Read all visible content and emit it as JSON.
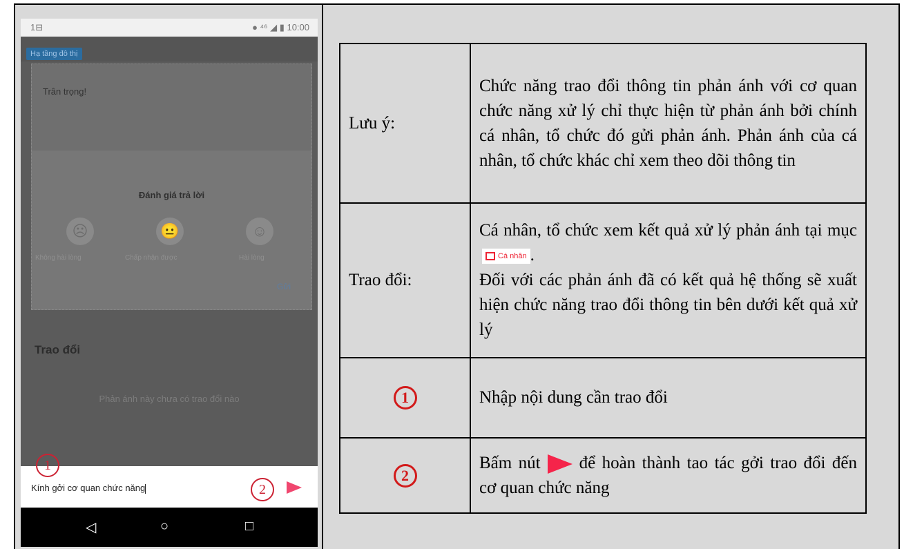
{
  "phone": {
    "status_left": "1⊟",
    "status_right": "● ⁴⁶ ◢ ▮ 10:00",
    "category_tag": "Hạ tầng đô thị",
    "greeting": "Trân trọng!",
    "rating_title": "Đánh giá trả lời",
    "rating_options": [
      "Không hài lòng",
      "Chấp nhận được",
      "Hài lòng"
    ],
    "rating_send": "Gửi",
    "section_title": "Trao đổi",
    "empty_note": "Phản ánh này chưa có trao đổi nào",
    "input_value": "Kính gởi cơ quan chức năng",
    "callout_1": "1",
    "callout_2": "2",
    "nav": {
      "back": "◁",
      "home": "○",
      "recent": "□"
    },
    "colors": {
      "send_arrow": "#f0476f",
      "callout": "#cc2233"
    }
  },
  "table": {
    "rows": [
      {
        "label": "Lưu ý:",
        "content": "Chức năng trao đổi thông tin phản ánh với cơ quan chức năng xử lý chỉ thực hiện từ phản ánh bởi chính cá nhân, tổ chức đó gửi phản ánh. Phản ánh của cá nhân, tổ chức khác chỉ xem theo dõi thông tin"
      },
      {
        "label": "Trao đổi:",
        "content_a": "Cá nhân, tổ chức xem kết quả xử lý phản ánh tại mục",
        "badge": "Cá nhân",
        "content_a_end": ".",
        "content_b": "Đối với các phản ánh đã có kết quả hệ thống sẽ xuất hiện chức năng trao đổi thông tin bên dưới kết quả xử lý"
      },
      {
        "label": "1",
        "content": "Nhập nội dung cần trao đổi"
      },
      {
        "label": "2",
        "content_a": "Bấm nút",
        "content_b": "để hoàn thành tao tác gởi trao đổi đến cơ quan chức năng"
      }
    ]
  }
}
